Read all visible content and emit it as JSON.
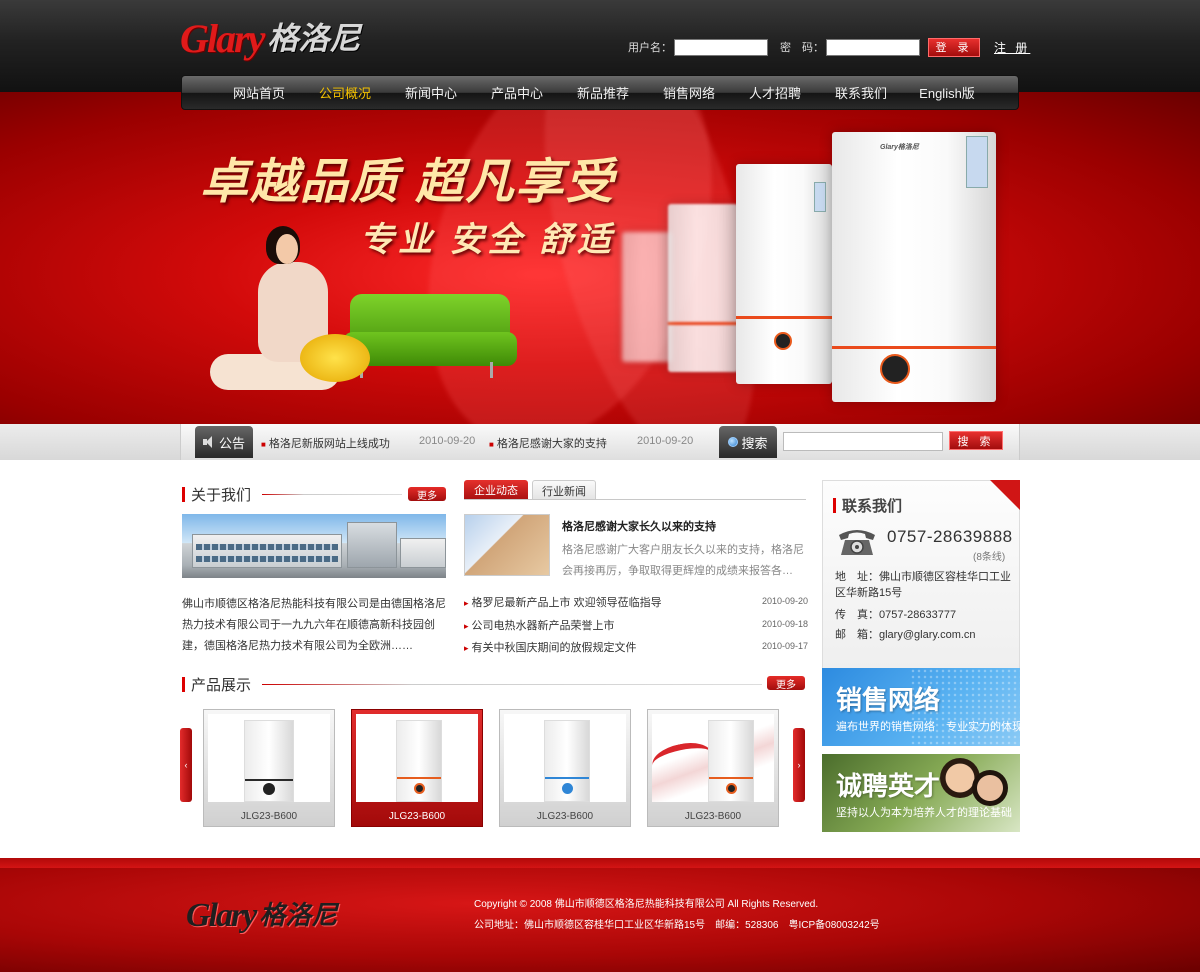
{
  "header": {
    "logo_en": "Glary",
    "logo_cn": "格洛尼",
    "username_label": "用户名：",
    "password_label": "密　码：",
    "login_button": "登 录",
    "register_link": "注 册"
  },
  "nav": {
    "items": [
      {
        "label": "网站首页",
        "active": false
      },
      {
        "label": "公司概况",
        "active": true
      },
      {
        "label": "新闻中心",
        "active": false
      },
      {
        "label": "产品中心",
        "active": false
      },
      {
        "label": "新品推荐",
        "active": false
      },
      {
        "label": "销售网络",
        "active": false
      },
      {
        "label": "人才招聘",
        "active": false
      },
      {
        "label": "联系我们",
        "active": false
      },
      {
        "label": "English版",
        "active": false
      }
    ]
  },
  "banner": {
    "slogan_main": "卓越品质 超凡享受",
    "slogan_sub": "专业 安全 舒适",
    "product_label": "Glary格洛尼"
  },
  "notice": {
    "label": "公告",
    "items": [
      {
        "text": "格洛尼新版网站上线成功",
        "date": "2010-09-20"
      },
      {
        "text": "格洛尼感谢大家的支持",
        "date": "2010-09-20"
      }
    ],
    "search_label": "搜索",
    "search_button": "搜 索",
    "search_placeholder": ""
  },
  "about": {
    "title": "关于我们",
    "more": "更多",
    "text": "佛山市顺德区格洛尼热能科技有限公司是由德国格洛尼热力技术有限公司于一九九六年在顺德高新科技园创建，德国格洛尼热力技术有限公司为全欧洲……"
  },
  "news": {
    "tabs": [
      {
        "label": "企业动态",
        "active": true
      },
      {
        "label": "行业新闻",
        "active": false
      }
    ],
    "featured": {
      "title": "格洛尼感谢大家长久以来的支持",
      "summary": "格洛尼感谢广大客户朋友长久以来的支持，格洛尼会再接再厉，争取取得更辉煌的成绩来报答各…"
    },
    "items": [
      {
        "text": "格罗尼最新产品上市 欢迎领导莅临指导",
        "date": "2010-09-20"
      },
      {
        "text": "公司电热水器新产品荣誉上市",
        "date": "2010-09-18"
      },
      {
        "text": "有关中秋国庆期间的放假规定文件",
        "date": "2010-09-17"
      }
    ]
  },
  "products": {
    "title": "产品展示",
    "more": "更多",
    "prev_arrow": "‹",
    "next_arrow": "›",
    "items": [
      {
        "name": "JLG23-B600",
        "accent": "#2a2a2a",
        "selected": false
      },
      {
        "name": "JLG23-B600",
        "accent": "#e65d1e",
        "selected": true
      },
      {
        "name": "JLG23-B600",
        "accent": "#2f86d6",
        "selected": false
      },
      {
        "name": "JLG23-B600",
        "accent": "#e65d1e",
        "selected": false
      }
    ]
  },
  "contact": {
    "title": "联系我们",
    "phone": "0757-28639888",
    "phone_note": "(8条线)",
    "address": "地　址：佛山市顺德区容桂华口工业区华新路15号",
    "fax": "传　真：0757-28633777",
    "email": "邮　箱：glary@glary.com.cn"
  },
  "promos": {
    "sales_title": "销售网络",
    "sales_sub": "遍布世界的销售网络　专业实力的体现",
    "hire_title": "诚聘英才",
    "hire_sub": "坚持以人为本为培养人才的理论基础"
  },
  "footer": {
    "logo_en": "Glary",
    "logo_cn": "格洛尼",
    "copyright": "Copyright © 2008 佛山市顺德区格洛尼热能科技有限公司 All Rights Reserved.",
    "address": "公司地址：佛山市顺德区容桂华口工业区华新路15号　邮编：528306　粤ICP备08003242号"
  },
  "colors": {
    "brand_red": "#d00000",
    "nav_active": "#f5c200",
    "dark_header": "#1a1a1a"
  }
}
